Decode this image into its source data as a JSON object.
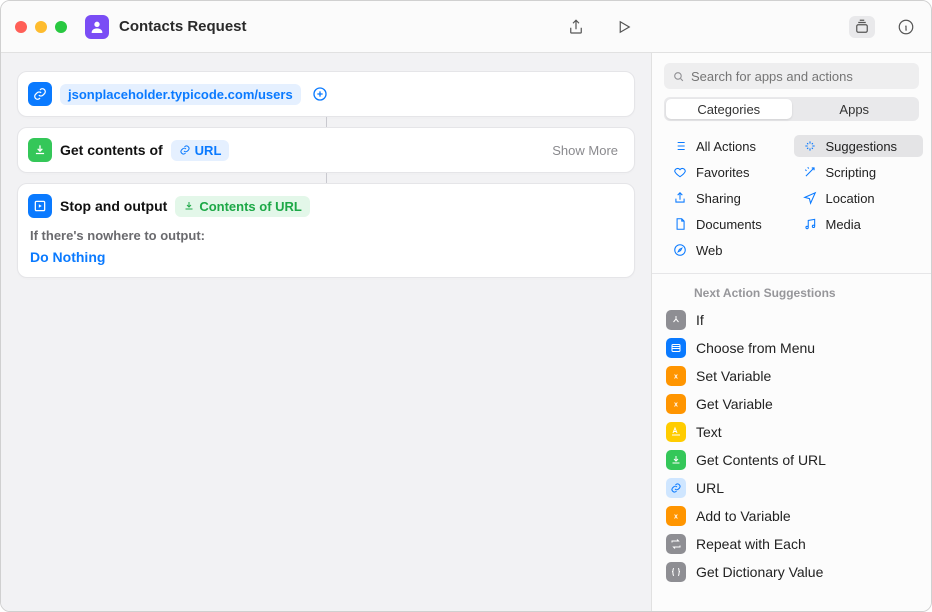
{
  "title": "Contacts Request",
  "search": {
    "placeholder": "Search for apps and actions"
  },
  "segments": {
    "categories": "Categories",
    "apps": "Apps",
    "active": "categories"
  },
  "actions": {
    "url": {
      "value": "jsonplaceholder.typicode.com/users"
    },
    "getContents": {
      "label": "Get contents of",
      "tokenLabel": "URL",
      "showMore": "Show More"
    },
    "output": {
      "label": "Stop and output",
      "tokenLabel": "Contents of URL",
      "secondaryLabel": "If there's nowhere to output:",
      "fallback": "Do Nothing"
    }
  },
  "categoriesLeft": [
    {
      "key": "all",
      "label": "All Actions",
      "icon": "list"
    },
    {
      "key": "favorites",
      "label": "Favorites",
      "icon": "heart"
    },
    {
      "key": "sharing",
      "label": "Sharing",
      "icon": "share"
    },
    {
      "key": "documents",
      "label": "Documents",
      "icon": "doc"
    },
    {
      "key": "web",
      "label": "Web",
      "icon": "safari"
    }
  ],
  "categoriesRight": [
    {
      "key": "suggestions",
      "label": "Suggestions",
      "icon": "sparkle",
      "selected": true
    },
    {
      "key": "scripting",
      "label": "Scripting",
      "icon": "wand"
    },
    {
      "key": "location",
      "label": "Location",
      "icon": "nav"
    },
    {
      "key": "media",
      "label": "Media",
      "icon": "music"
    }
  ],
  "suggestionsHeader": "Next Action Suggestions",
  "suggestions": [
    {
      "label": "If",
      "color": "#8e8e93",
      "icon": "branch"
    },
    {
      "label": "Choose from Menu",
      "color": "#0a7aff",
      "icon": "menu"
    },
    {
      "label": "Set Variable",
      "color": "#ff9500",
      "icon": "var"
    },
    {
      "label": "Get Variable",
      "color": "#ff9500",
      "icon": "var"
    },
    {
      "label": "Text",
      "color": "#ffcc00",
      "icon": "text"
    },
    {
      "label": "Get Contents of URL",
      "color": "#34c759",
      "icon": "download"
    },
    {
      "label": "URL",
      "color": "#cfe6ff",
      "icon": "link",
      "fg": "#0a7aff"
    },
    {
      "label": "Add to Variable",
      "color": "#ff9500",
      "icon": "var"
    },
    {
      "label": "Repeat with Each",
      "color": "#8e8e93",
      "icon": "repeat"
    },
    {
      "label": "Get Dictionary Value",
      "color": "#8e8e93",
      "icon": "dict"
    }
  ]
}
